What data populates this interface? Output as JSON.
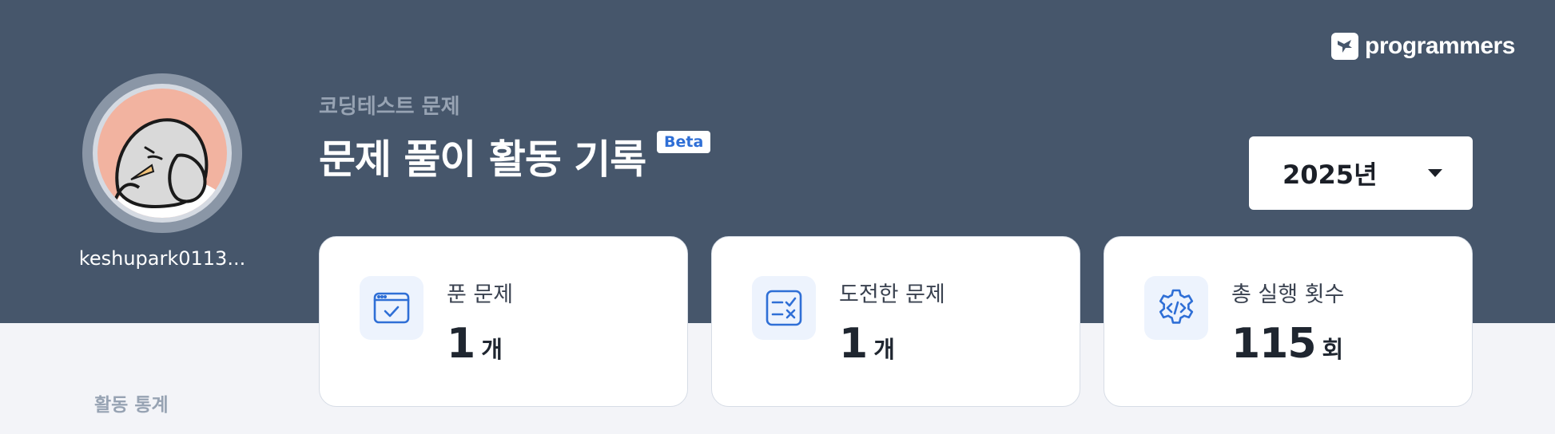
{
  "brand": {
    "name": "programmers"
  },
  "profile": {
    "username": "keshupark0113..."
  },
  "header": {
    "subtitle": "코딩테스트 문제",
    "title": "문제 풀이 활동 기록",
    "badge": "Beta"
  },
  "year_select": {
    "selected": "2025년"
  },
  "stats": [
    {
      "label": "푼 문제",
      "value": "1",
      "unit": "개",
      "icon": "solved-check-icon"
    },
    {
      "label": "도전한 문제",
      "value": "1",
      "unit": "개",
      "icon": "checklist-icon"
    },
    {
      "label": "총 실행 횟수",
      "value": "115",
      "unit": "회",
      "icon": "code-gear-icon"
    }
  ],
  "sidebar": {
    "section_label": "활동 통계"
  },
  "colors": {
    "header_bg": "#46566b",
    "page_bg": "#f3f4f8",
    "accent": "#2f6fd6",
    "icon_bg": "#edf3fd",
    "avatar_bg": "#f2b3a0"
  }
}
